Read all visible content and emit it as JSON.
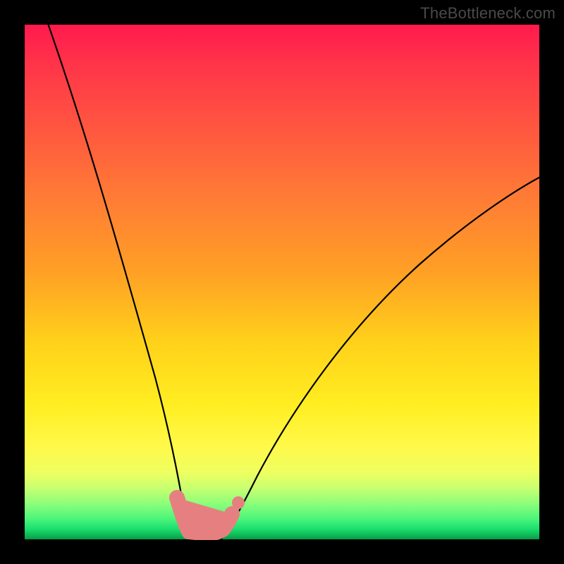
{
  "watermark": "TheBottleneck.com",
  "colors": {
    "frame": "#000000",
    "curve": "#000000",
    "marker": "#e68080",
    "gradient_top": "#ff1a4d",
    "gradient_mid": "#ffd21a",
    "gradient_bottom": "#0a9a46"
  },
  "chart_data": {
    "type": "line",
    "title": "",
    "xlabel": "",
    "ylabel": "",
    "xlim": [
      0,
      100
    ],
    "ylim": [
      0,
      100
    ],
    "grid": false,
    "legend": false,
    "annotations": [
      "TheBottleneck.com"
    ],
    "series": [
      {
        "name": "left-curve",
        "x": [
          4,
          8,
          12,
          16,
          20,
          24,
          26,
          28,
          29,
          30,
          31
        ],
        "y": [
          100,
          82,
          64,
          47,
          32,
          18,
          12,
          6,
          3,
          1,
          0
        ]
      },
      {
        "name": "right-curve",
        "x": [
          38,
          40,
          42,
          46,
          52,
          60,
          70,
          82,
          96,
          100
        ],
        "y": [
          0,
          2,
          5,
          11,
          20,
          31,
          43,
          55,
          67,
          70
        ]
      },
      {
        "name": "highlighted-region",
        "x": [
          28,
          29,
          30,
          31,
          33,
          35,
          37,
          38,
          39,
          40
        ],
        "y": [
          6,
          3,
          1,
          0,
          0,
          0,
          0,
          0,
          1,
          3
        ]
      }
    ],
    "markers": [
      {
        "x": 41.5,
        "y": 4.5
      }
    ]
  }
}
